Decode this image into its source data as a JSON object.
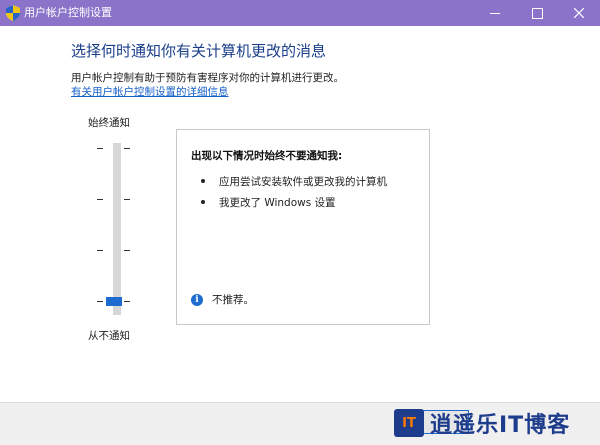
{
  "window": {
    "title": "用户帐户控制设置"
  },
  "main": {
    "heading": "选择何时通知你有关计算机更改的消息",
    "description": "用户帐户控制有助于预防有害程序对你的计算机进行更改。",
    "more_link": "有关用户帐户控制设置的详细信息"
  },
  "slider": {
    "top_label": "始终通知",
    "bottom_label": "从不通知",
    "levels": 4,
    "selected_level": 1,
    "accent_color": "#1e6cd0"
  },
  "panel": {
    "title": "出现以下情况时始终不要通知我:",
    "bullets": [
      "应用尝试安装软件或更改我的计算机",
      "我更改了 Windows 设置"
    ],
    "note": "不推荐。"
  },
  "watermark": {
    "logo": "IT",
    "text": "逍遥乐IT博客"
  },
  "colors": {
    "titlebar": "#8a73c8",
    "heading": "#1a3e8a",
    "link": "#1660c8"
  }
}
